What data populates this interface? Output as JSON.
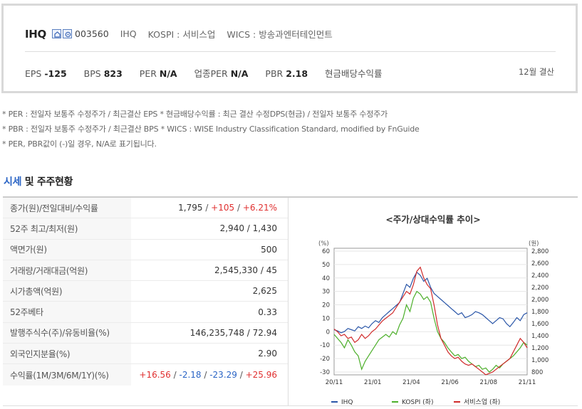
{
  "header": {
    "stock_name": "IHQ",
    "code": "003560",
    "english_name": "IHQ",
    "market": "KOSPI : 서비스업",
    "wics": "WICS : 방송과엔터테인먼트",
    "icons": [
      "company-icon",
      "report-icon"
    ],
    "metrics": [
      {
        "label": "EPS",
        "value": "-125"
      },
      {
        "label": "BPS",
        "value": "823"
      },
      {
        "label": "PER",
        "value": "N/A"
      },
      {
        "label": "업종PER",
        "value": "N/A"
      },
      {
        "label": "PBR",
        "value": "2.18"
      },
      {
        "label": "현금배당수익률",
        "value": ""
      }
    ],
    "fiscal": "12월 결산"
  },
  "notes": [
    "* PER : 전일자 보통주 수정주가 / 최근결산 EPS * 현금배당수익률 : 최근 결산 수정DPS(현금) / 전일자 보통주 수정주가",
    "* PBR : 전일자 보통주 수정주가 / 최근결산 BPS * WICS : WISE Industry Classification Standard, modified by FnGuide",
    "* PER, PBR값이 (-)일 경우, N/A로 표기됩니다."
  ],
  "section": {
    "title_highlight": "시세",
    "title_rest": " 및 주주현황"
  },
  "table": {
    "rows": [
      {
        "label": "종가(원)/전일대비/수익률",
        "parts": [
          {
            "t": "1,795",
            "c": "n"
          },
          {
            "t": " / ",
            "c": "s"
          },
          {
            "t": "+105",
            "c": "u"
          },
          {
            "t": " / ",
            "c": "s"
          },
          {
            "t": "+6.21%",
            "c": "u"
          }
        ]
      },
      {
        "label": "52주 최고/최저(원)",
        "parts": [
          {
            "t": "2,940 / 1,430",
            "c": "n"
          }
        ]
      },
      {
        "label": "액면가(원)",
        "parts": [
          {
            "t": "500",
            "c": "n"
          }
        ]
      },
      {
        "label": "거래량/거래대금(억원)",
        "parts": [
          {
            "t": "2,545,330 / 45",
            "c": "n"
          }
        ]
      },
      {
        "label": "시가총액(억원)",
        "parts": [
          {
            "t": "2,625",
            "c": "n"
          }
        ]
      },
      {
        "label": "52주베타",
        "parts": [
          {
            "t": "0.33",
            "c": "n"
          }
        ]
      },
      {
        "label": "발행주식수(주)/유동비율(%)",
        "parts": [
          {
            "t": "146,235,748 / 72.94",
            "c": "n"
          }
        ]
      },
      {
        "label": "외국인지분율(%)",
        "parts": [
          {
            "t": "2.90",
            "c": "n"
          }
        ]
      },
      {
        "label": "수익률(1M/3M/6M/1Y)(%)",
        "parts": [
          {
            "t": "+16.56",
            "c": "u"
          },
          {
            "t": " / ",
            "c": "s"
          },
          {
            "t": "-2.18",
            "c": "d"
          },
          {
            "t": " / ",
            "c": "s"
          },
          {
            "t": "-23.29",
            "c": "d"
          },
          {
            "t": " / ",
            "c": "s"
          },
          {
            "t": "+25.96",
            "c": "u"
          }
        ]
      }
    ]
  },
  "chart_data": {
    "type": "line",
    "title": "<주가/상대수익률 추이>",
    "left_unit": "(%)",
    "right_unit": "(원)",
    "y_left_ticks": [
      "60",
      "50",
      "40",
      "30",
      "20",
      "10",
      "0",
      "-10",
      "-20",
      "-30"
    ],
    "y_left_range": [
      -30,
      60
    ],
    "y_right_ticks": [
      "2,800",
      "2,600",
      "2,400",
      "2,200",
      "2,000",
      "1,800",
      "1,600",
      "1,400",
      "1,200",
      "1,000",
      "800"
    ],
    "y_right_range": [
      800,
      2800
    ],
    "x_ticks": [
      "20/11",
      "21/01",
      "21/04",
      "21/06",
      "21/08",
      "21/11"
    ],
    "series": [
      {
        "name": "IHQ",
        "color": "#2a56a8",
        "axis": "right",
        "values": [
          1500,
          1480,
          1450,
          1470,
          1520,
          1500,
          1480,
          1550,
          1520,
          1560,
          1530,
          1600,
          1650,
          1620,
          1700,
          1750,
          1800,
          1850,
          1900,
          1950,
          2100,
          2250,
          2200,
          2350,
          2450,
          2400,
          2300,
          2350,
          2200,
          2100,
          2050,
          2000,
          1950,
          1900,
          1850,
          1800,
          1750,
          1780,
          1700,
          1720,
          1750,
          1800,
          1780,
          1750,
          1700,
          1650,
          1600,
          1650,
          1700,
          1680,
          1600,
          1550,
          1620,
          1700,
          1650,
          1750,
          1780
        ]
      },
      {
        "name": "KOSPI (좌)",
        "color": "#4caf2a",
        "axis": "left",
        "values": [
          -2,
          -5,
          -8,
          -12,
          -6,
          -10,
          -15,
          -18,
          -28,
          -22,
          -18,
          -14,
          -10,
          -6,
          -4,
          -2,
          -4,
          0,
          -2,
          5,
          10,
          20,
          15,
          25,
          30,
          28,
          24,
          26,
          22,
          10,
          0,
          -5,
          -8,
          -12,
          -15,
          -18,
          -17,
          -20,
          -19,
          -22,
          -24,
          -26,
          -25,
          -28,
          -27,
          -30,
          -28,
          -25,
          -27,
          -24,
          -22,
          -20,
          -18,
          -15,
          -12,
          -8,
          -10
        ]
      },
      {
        "name": "서비스업 (좌)",
        "color": "#d02a2a",
        "axis": "left",
        "values": [
          2,
          0,
          -3,
          -2,
          -5,
          -4,
          -8,
          -6,
          -2,
          -5,
          -3,
          0,
          2,
          5,
          8,
          10,
          12,
          14,
          18,
          22,
          26,
          30,
          28,
          35,
          45,
          48,
          40,
          35,
          32,
          20,
          5,
          -5,
          -10,
          -15,
          -18,
          -20,
          -19,
          -22,
          -24,
          -25,
          -24,
          -26,
          -28,
          -30,
          -32,
          -31,
          -30,
          -28,
          -26,
          -24,
          -22,
          -20,
          -15,
          -10,
          -5,
          -8,
          -12
        ]
      }
    ]
  }
}
